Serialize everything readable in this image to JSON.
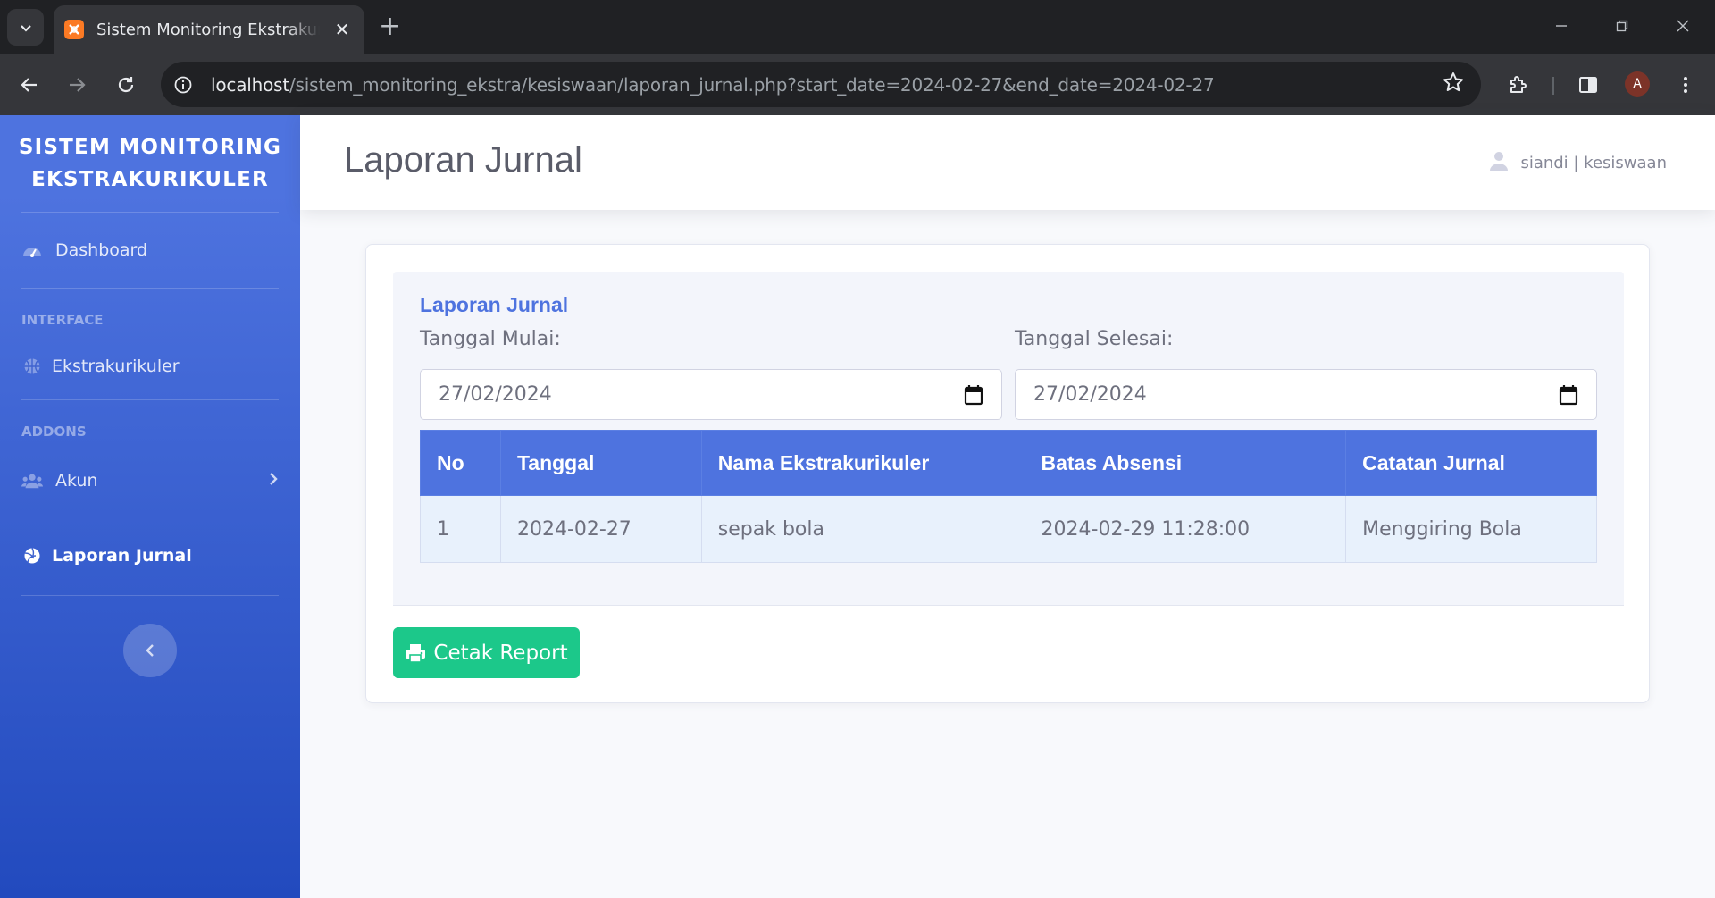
{
  "browser": {
    "tab_title": "Sistem Monitoring Ekstrakurikuler",
    "url_host": "localhost",
    "url_path": "/sistem_monitoring_ekstra/kesiswaan/laporan_jurnal.php?start_date=2024-02-27&end_date=2024-02-27",
    "profile_initial": "A",
    "new_tab_symbol": "+",
    "close_symbol": "✕"
  },
  "sidebar": {
    "brand_line1": "SISTEM MONITORING",
    "brand_line2": "EKSTRAKURIKULER",
    "items": [
      {
        "label": "Dashboard",
        "icon": "tachometer-icon"
      },
      {
        "heading": "INTERFACE"
      },
      {
        "label": "Ekstrakurikuler",
        "icon": "basketball-icon"
      },
      {
        "heading": "ADDONS"
      },
      {
        "label": "Akun",
        "icon": "users-icon"
      },
      {
        "label": "Laporan Jurnal",
        "icon": "volleyball-icon",
        "active": true
      }
    ]
  },
  "topbar": {
    "page_title": "Laporan Jurnal",
    "user": "siandi | kesiswaan"
  },
  "report": {
    "heading": "Laporan Jurnal",
    "start_label": "Tanggal Mulai:",
    "start_value": "27/02/2024",
    "end_label": "Tanggal Selesai:",
    "end_value": "27/02/2024",
    "columns": [
      "No",
      "Tanggal",
      "Nama Ekstrakurikuler",
      "Batas Absensi",
      "Catatan Jurnal"
    ],
    "rows": [
      [
        "1",
        "2024-02-27",
        "sepak bola",
        "2024-02-29 11:28:00",
        "Menggiring Bola"
      ]
    ],
    "print_label": "Cetak Report"
  },
  "colors": {
    "primary": "#4e73df",
    "success": "#1cc88a",
    "sidebar_start": "#4e73df",
    "sidebar_end": "#224abe"
  }
}
